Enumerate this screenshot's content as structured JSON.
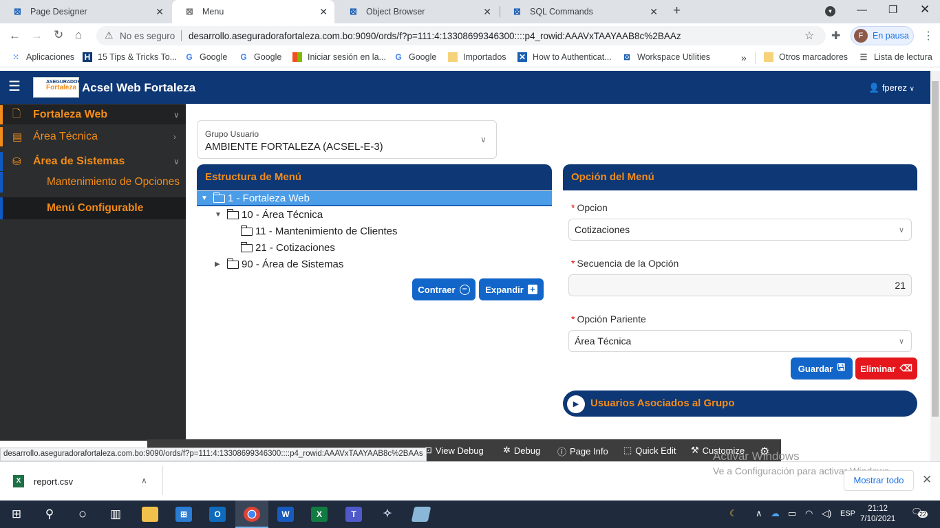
{
  "browser": {
    "tabs": [
      {
        "label": "Page Designer",
        "active": false
      },
      {
        "label": "Menu",
        "active": true
      },
      {
        "label": "Object Browser",
        "active": false
      },
      {
        "label": "SQL Commands",
        "active": false
      }
    ],
    "omnibox": {
      "security": "No es seguro",
      "url": "desarrollo.aseguradorafortaleza.com.bo:9090/ords/f?p=111:4:13308699346300::::p4_rowid:AAAVxTAAYAAB8c%2BAAz"
    },
    "profile": {
      "initial": "F",
      "label": "En pausa"
    },
    "bookmarks": [
      {
        "label": "Aplicaciones",
        "icon": "apps-grid-icon"
      },
      {
        "label": "15 Tips & Tricks To...",
        "icon": "h-icon"
      },
      {
        "label": "Google",
        "icon": "google-icon"
      },
      {
        "label": "Google",
        "icon": "google-icon"
      },
      {
        "label": "Iniciar sesión en la...",
        "icon": "microsoft-icon"
      },
      {
        "label": "Google",
        "icon": "google-icon"
      },
      {
        "label": "Importados",
        "icon": "folder-icon"
      },
      {
        "label": "How to Authenticat...",
        "icon": "x-icon"
      },
      {
        "label": "Workspace Utilities",
        "icon": "apex-icon"
      },
      {
        "label": "Otros marcadores",
        "icon": "folder-icon"
      },
      {
        "label": "Lista de lectura",
        "icon": "reading-list-icon"
      }
    ],
    "bookmarks_more": "»",
    "status_url": "desarrollo.aseguradorafortaleza.com.bo:9090/ords/f?p=111:4:13308699346300::::p4_rowid:AAAVxTAAYAAB8c%2BAAs"
  },
  "app": {
    "logo_top": "ASEGURADORA",
    "logo_bottom": "Fortaleza",
    "title": "Acsel Web Fortaleza",
    "user": "fperez",
    "sidebar": [
      {
        "label": "Fortaleza Web",
        "icon": "document-icon"
      },
      {
        "label": "Área Técnica",
        "icon": "calculator-icon"
      },
      {
        "label": "Área de Sistemas",
        "icon": "database-icon"
      },
      {
        "label": "Mantenimiento de Opciones"
      },
      {
        "label": "Menú Configurable"
      }
    ],
    "grupo": {
      "label": "Grupo Usuario",
      "value": "AMBIENTE FORTALEZA (ACSEL-E-3)"
    },
    "left_panel": {
      "title": "Estructura de Menú",
      "tree": [
        {
          "label": "1 - Fortaleza Web",
          "state": "expanded"
        },
        {
          "label": "10 - Área Técnica",
          "state": "expanded"
        },
        {
          "label": "11 - Mantenimiento de Clientes",
          "state": "leaf"
        },
        {
          "label": "21 - Cotizaciones",
          "state": "leaf"
        },
        {
          "label": "90 - Área de Sistemas",
          "state": "collapsed"
        }
      ],
      "contraer": "Contraer",
      "expandir": "Expandir"
    },
    "right_panel": {
      "title": "Opción del Menú",
      "required_mark": "*",
      "opcion_label": "Opcion",
      "opcion_value": "Cotizaciones",
      "secuencia_label": "Secuencia de la Opción",
      "secuencia_value": "21",
      "pariente_label": "Opción Pariente",
      "pariente_value": "Área Técnica",
      "guardar": "Guardar",
      "eliminar": "Eliminar"
    },
    "usuarios_asociados": "Usuarios Asociados al Grupo"
  },
  "devbar": [
    "View Debug",
    "Debug",
    "Page Info",
    "Quick Edit",
    "Customize"
  ],
  "downloads": {
    "file": "report.csv",
    "show_all": "Mostrar todo"
  },
  "watermark": {
    "line1": "Activar Windows",
    "line2": "Ve a Configuración para activar Windows."
  },
  "taskbar": {
    "lang": "ESP",
    "time": "21:12",
    "date": "7/10/2021",
    "notif": "22"
  }
}
